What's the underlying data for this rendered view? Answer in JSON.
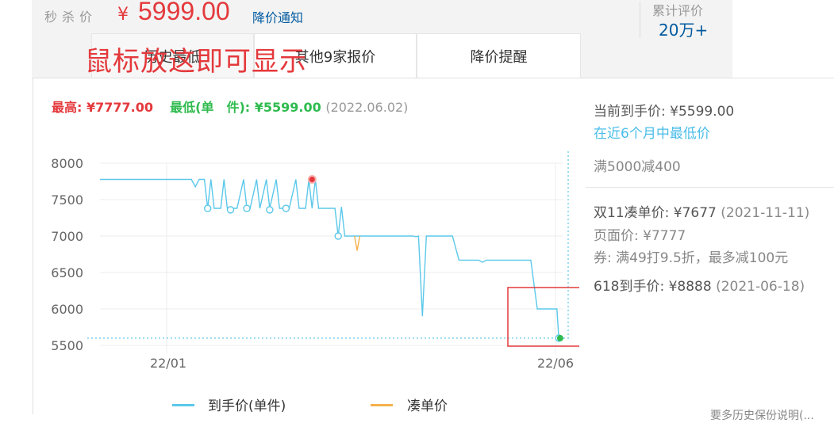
{
  "header": {
    "seckill_label": "秒杀价",
    "currency": "¥",
    "price": "5999.00",
    "drop_notice": "降价通知",
    "review_label": "累计评价",
    "review_count": "20万+"
  },
  "tabs": [
    {
      "label": "历史最低"
    },
    {
      "label": "其他9家报价"
    },
    {
      "label": "降价提醒"
    }
  ],
  "overlay_text": "鼠标放这即可显示",
  "chart_panel": {
    "high_label": "最高: ¥7777.00",
    "low_label": "最低(单　件): ¥5599.00",
    "low_date": "(2022.06.02)",
    "side": {
      "current": "当前到手价: ¥5599.00",
      "current_note": "在近6个月中最低价",
      "promo": "满5000减400",
      "double11_label": "双11凑单价: ¥7677",
      "double11_date": "(2021-11-11)",
      "page_price": "页面价: ¥7777",
      "coupon": "券: 满49打9.5折，最多减100元",
      "d618_label": "618到手价: ¥8888",
      "d618_date": "(2021-06-18)"
    },
    "legend": {
      "series1": "到手价(单件)",
      "series2": "凑单价"
    },
    "clipped_text": "要多历史保份说明(..."
  },
  "chart_data": {
    "type": "line",
    "ylim": [
      5500,
      8000
    ],
    "yticks": [
      8000,
      7500,
      7000,
      6500,
      6000,
      5500
    ],
    "xtick_labels": [
      "22/01",
      "22/06"
    ],
    "series": [
      {
        "name": "到手价(单件)",
        "color": "#5bc8ea",
        "points": [
          [
            0,
            7777
          ],
          [
            14,
            7777
          ],
          [
            14.6,
            7677
          ],
          [
            15.2,
            7777
          ],
          [
            16,
            7777
          ],
          [
            16.5,
            7380
          ],
          [
            17,
            7777
          ],
          [
            17.5,
            7380
          ],
          [
            18.5,
            7380
          ],
          [
            19,
            7777
          ],
          [
            19.5,
            7380
          ],
          [
            21,
            7380
          ],
          [
            22,
            7777
          ],
          [
            22.5,
            7380
          ],
          [
            23,
            7380
          ],
          [
            24,
            7777
          ],
          [
            24.5,
            7380
          ],
          [
            25.5,
            7777
          ],
          [
            26,
            7380
          ],
          [
            27,
            7777
          ],
          [
            27.5,
            7380
          ],
          [
            29,
            7380
          ],
          [
            30,
            7777
          ],
          [
            30.5,
            7380
          ],
          [
            31.5,
            7380
          ],
          [
            32,
            7777
          ],
          [
            32.5,
            7380
          ],
          [
            33,
            7777
          ],
          [
            33.5,
            7380
          ],
          [
            36,
            7380
          ],
          [
            36.5,
            7000
          ],
          [
            37,
            7400
          ],
          [
            37.5,
            7000
          ],
          [
            48,
            7000
          ],
          [
            48.4,
            6990
          ],
          [
            48.8,
            7000
          ],
          [
            49.4,
            5900
          ],
          [
            50,
            7000
          ],
          [
            54,
            7000
          ],
          [
            55,
            6670
          ],
          [
            58,
            6670
          ],
          [
            58.6,
            6640
          ],
          [
            59.2,
            6670
          ],
          [
            66,
            6670
          ],
          [
            67,
            6000
          ],
          [
            70,
            6000
          ],
          [
            70.3,
            5599
          ],
          [
            71,
            5599
          ]
        ]
      },
      {
        "name": "凑单价",
        "color": "#f5b14c",
        "points": [
          [
            39,
            7000
          ],
          [
            39.4,
            6800
          ],
          [
            39.8,
            7000
          ]
        ]
      }
    ],
    "markers": {
      "high": [
        32.5,
        7777
      ],
      "low": [
        70.5,
        5599
      ],
      "hollow": [
        [
          16.5,
          7380
        ],
        [
          20,
          7360
        ],
        [
          22.5,
          7380
        ],
        [
          26,
          7360
        ],
        [
          28.5,
          7380
        ],
        [
          36.5,
          7000
        ],
        [
          70.3,
          5599
        ]
      ]
    }
  }
}
